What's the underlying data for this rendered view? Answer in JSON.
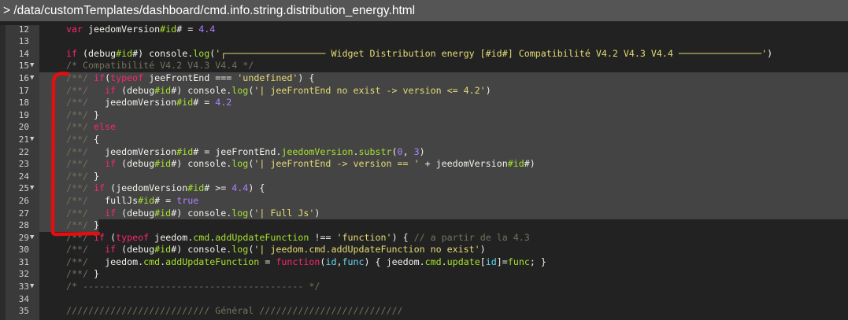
{
  "title_bar": {
    "path": "> /data/customTemplates/dashboard/cmd.info.string.distribution_energy.html"
  },
  "editor": {
    "selection": {
      "from_line": 16,
      "to_line": 28
    },
    "annotation_color": "#e01010",
    "lines": [
      {
        "num": "12",
        "fold": false,
        "tokens": [
          [
            "k",
            "var"
          ],
          [
            "d",
            " jeedomVersion"
          ],
          [
            "p",
            "#id"
          ],
          [
            "d",
            "# = "
          ],
          [
            "n",
            "4.4"
          ]
        ]
      },
      {
        "num": "13",
        "fold": false,
        "tokens": []
      },
      {
        "num": "14",
        "fold": false,
        "tokens": [
          [
            "k",
            "if"
          ],
          [
            "d",
            " (debug"
          ],
          [
            "p",
            "#id"
          ],
          [
            "d",
            "#) console."
          ],
          [
            "p",
            "log"
          ],
          [
            "d",
            "("
          ],
          [
            "s",
            "'┌────────────────── Widget Distribution energy [#id#] Compatibilité V4.2 V4.3 V4.4 ───────────────'"
          ],
          [
            "d",
            ")"
          ]
        ]
      },
      {
        "num": "15",
        "fold": true,
        "tokens": [
          [
            "c",
            "/* Compatibilité V4.2 V4.3 V4.4 */"
          ]
        ]
      },
      {
        "num": "16",
        "fold": true,
        "tokens": [
          [
            "c",
            "/**/ "
          ],
          [
            "k",
            "if"
          ],
          [
            "d",
            "("
          ],
          [
            "k",
            "typeof"
          ],
          [
            "d",
            " jeeFrontEnd === "
          ],
          [
            "s",
            "'undefined'"
          ],
          [
            "d",
            ") {"
          ]
        ]
      },
      {
        "num": "17",
        "fold": false,
        "tokens": [
          [
            "c",
            "/**/   "
          ],
          [
            "k",
            "if"
          ],
          [
            "d",
            " (debug"
          ],
          [
            "p",
            "#id"
          ],
          [
            "d",
            "#) console."
          ],
          [
            "p",
            "log"
          ],
          [
            "d",
            "("
          ],
          [
            "s",
            "'| jeeFrontEnd no exist -> version <= 4.2'"
          ],
          [
            "d",
            ")"
          ]
        ]
      },
      {
        "num": "18",
        "fold": false,
        "tokens": [
          [
            "c",
            "/**/   "
          ],
          [
            "d",
            "jeedomVersion"
          ],
          [
            "p",
            "#id"
          ],
          [
            "d",
            "# = "
          ],
          [
            "n",
            "4.2"
          ]
        ]
      },
      {
        "num": "19",
        "fold": false,
        "tokens": [
          [
            "c",
            "/**/ "
          ],
          [
            "d",
            "}"
          ]
        ]
      },
      {
        "num": "20",
        "fold": false,
        "tokens": [
          [
            "c",
            "/**/ "
          ],
          [
            "k",
            "else"
          ]
        ]
      },
      {
        "num": "21",
        "fold": true,
        "tokens": [
          [
            "c",
            "/**/ "
          ],
          [
            "d",
            "{"
          ]
        ]
      },
      {
        "num": "22",
        "fold": false,
        "tokens": [
          [
            "c",
            "/**/   "
          ],
          [
            "d",
            "jeedomVersion"
          ],
          [
            "p",
            "#id"
          ],
          [
            "d",
            "# = jeeFrontEnd."
          ],
          [
            "p",
            "jeedomVersion"
          ],
          [
            "d",
            "."
          ],
          [
            "p",
            "substr"
          ],
          [
            "d",
            "("
          ],
          [
            "n",
            "0"
          ],
          [
            "d",
            ", "
          ],
          [
            "n",
            "3"
          ],
          [
            "d",
            ")"
          ]
        ]
      },
      {
        "num": "23",
        "fold": false,
        "tokens": [
          [
            "c",
            "/**/   "
          ],
          [
            "k",
            "if"
          ],
          [
            "d",
            " (debug"
          ],
          [
            "p",
            "#id"
          ],
          [
            "d",
            "#) console."
          ],
          [
            "p",
            "log"
          ],
          [
            "d",
            "("
          ],
          [
            "s",
            "'| jeeFrontEnd -> version == '"
          ],
          [
            "d",
            " + jeedomVersion"
          ],
          [
            "p",
            "#id"
          ],
          [
            "d",
            "#)"
          ]
        ]
      },
      {
        "num": "24",
        "fold": false,
        "tokens": [
          [
            "c",
            "/**/ "
          ],
          [
            "d",
            "}"
          ]
        ]
      },
      {
        "num": "25",
        "fold": true,
        "tokens": [
          [
            "c",
            "/**/ "
          ],
          [
            "k",
            "if"
          ],
          [
            "d",
            " (jeedomVersion"
          ],
          [
            "p",
            "#id"
          ],
          [
            "d",
            "# >= "
          ],
          [
            "n",
            "4.4"
          ],
          [
            "d",
            ") {"
          ]
        ]
      },
      {
        "num": "26",
        "fold": false,
        "tokens": [
          [
            "c",
            "/**/   "
          ],
          [
            "d",
            "fullJs"
          ],
          [
            "p",
            "#id"
          ],
          [
            "d",
            "# = "
          ],
          [
            "n",
            "true"
          ]
        ]
      },
      {
        "num": "27",
        "fold": false,
        "tokens": [
          [
            "c",
            "/**/   "
          ],
          [
            "k",
            "if"
          ],
          [
            "d",
            " (debug"
          ],
          [
            "p",
            "#id"
          ],
          [
            "d",
            "#) console."
          ],
          [
            "p",
            "log"
          ],
          [
            "d",
            "("
          ],
          [
            "s",
            "'| Full Js'"
          ],
          [
            "d",
            ")"
          ]
        ]
      },
      {
        "num": "28",
        "fold": false,
        "tokens": [
          [
            "c",
            "/**/ "
          ],
          [
            "d",
            "}"
          ]
        ]
      },
      {
        "num": "29",
        "fold": true,
        "tokens": [
          [
            "c",
            "/**/ "
          ],
          [
            "k",
            "if"
          ],
          [
            "d",
            " ("
          ],
          [
            "k",
            "typeof"
          ],
          [
            "d",
            " jeedom."
          ],
          [
            "p",
            "cmd"
          ],
          [
            "d",
            "."
          ],
          [
            "p",
            "addUpdateFunction"
          ],
          [
            "d",
            " !== "
          ],
          [
            "s",
            "'function'"
          ],
          [
            "d",
            ") { "
          ],
          [
            "c",
            "// a partir de la 4.3"
          ]
        ]
      },
      {
        "num": "30",
        "fold": false,
        "tokens": [
          [
            "c",
            "/**/   "
          ],
          [
            "k",
            "if"
          ],
          [
            "d",
            " (debug"
          ],
          [
            "p",
            "#id"
          ],
          [
            "d",
            "#) console."
          ],
          [
            "p",
            "log"
          ],
          [
            "d",
            "("
          ],
          [
            "s",
            "'| jeedom.cmd.addUpdateFunction no exist'"
          ],
          [
            "d",
            ")"
          ]
        ]
      },
      {
        "num": "31",
        "fold": false,
        "tokens": [
          [
            "c",
            "/**/   "
          ],
          [
            "d",
            "jeedom."
          ],
          [
            "p",
            "cmd"
          ],
          [
            "d",
            "."
          ],
          [
            "p",
            "addUpdateFunction"
          ],
          [
            "d",
            " = "
          ],
          [
            "k",
            "function"
          ],
          [
            "d",
            "("
          ],
          [
            "v",
            "id"
          ],
          [
            "d",
            ","
          ],
          [
            "v",
            "func"
          ],
          [
            "d",
            ") { jeedom."
          ],
          [
            "p",
            "cmd"
          ],
          [
            "d",
            "."
          ],
          [
            "p",
            "update"
          ],
          [
            "d",
            "["
          ],
          [
            "v",
            "id"
          ],
          [
            "d",
            "]="
          ],
          [
            "p",
            "func"
          ],
          [
            "d",
            "; }"
          ]
        ]
      },
      {
        "num": "32",
        "fold": false,
        "tokens": [
          [
            "c",
            "/**/ "
          ],
          [
            "d",
            "}"
          ]
        ]
      },
      {
        "num": "33",
        "fold": true,
        "tokens": [
          [
            "c",
            "/* ---------------------------------------- */"
          ]
        ]
      },
      {
        "num": "34",
        "fold": false,
        "tokens": []
      },
      {
        "num": "35",
        "fold": false,
        "tokens": [
          [
            "c",
            "////////////////////////// Général //////////////////////////"
          ]
        ]
      }
    ]
  }
}
